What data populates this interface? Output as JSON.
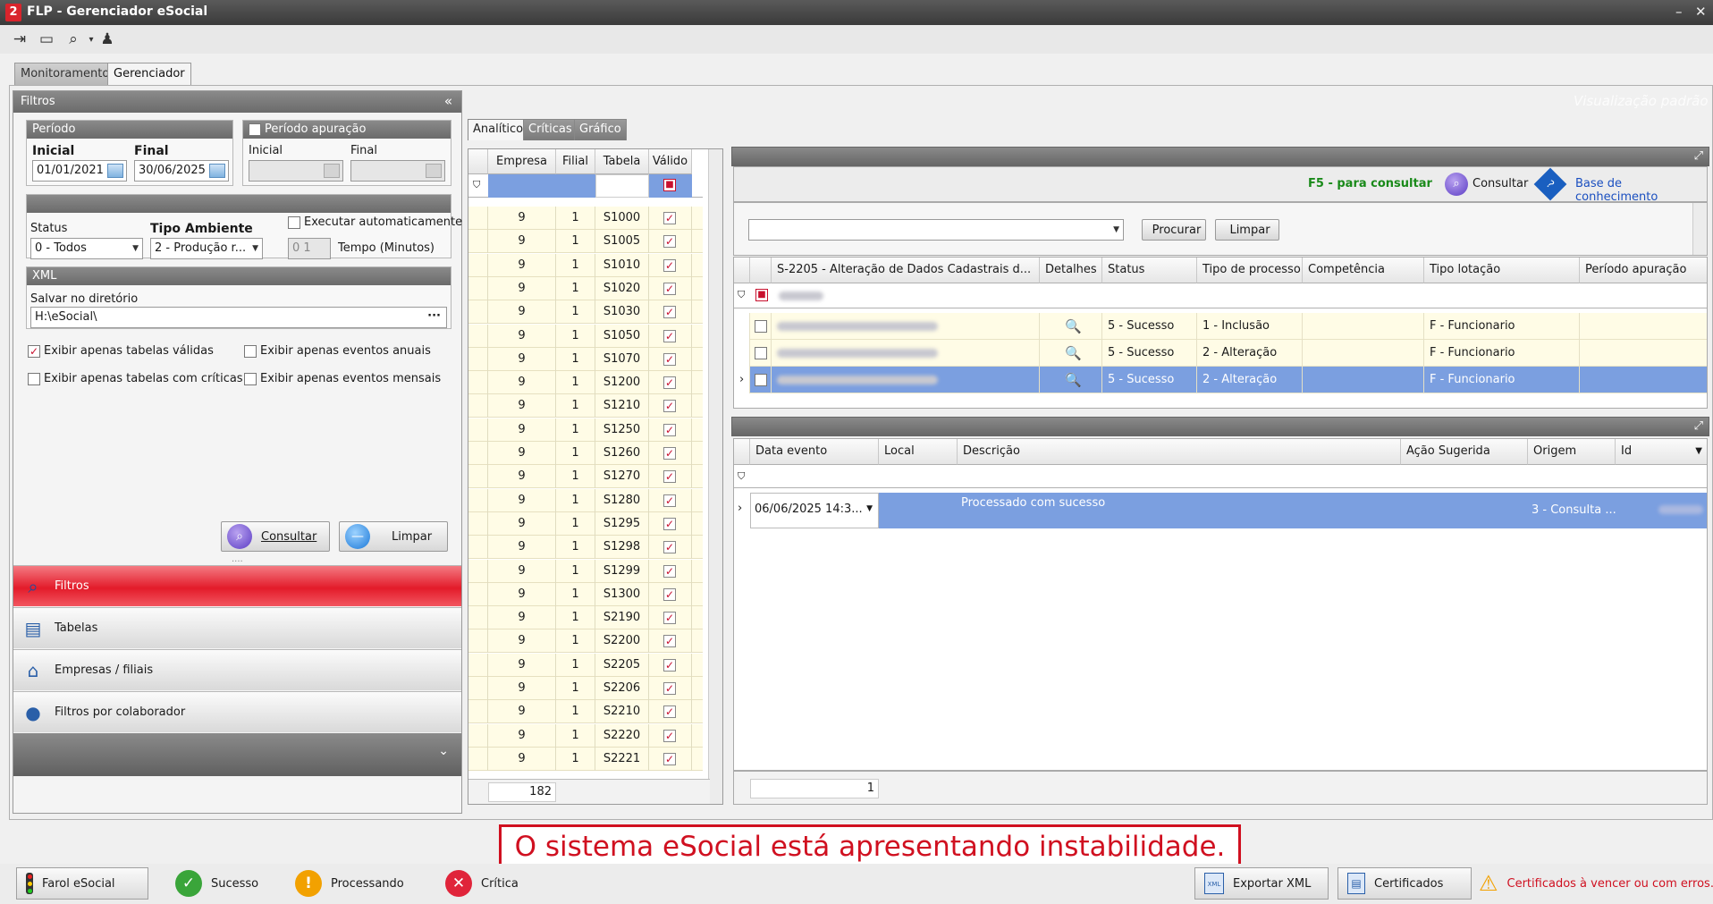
{
  "window": {
    "title": "FLP - Gerenciador eSocial",
    "logo": "2"
  },
  "toolbar": {
    "icons": [
      "exit-icon",
      "monitor-icon",
      "zoom-icon",
      "user-icon"
    ]
  },
  "main_tabs": [
    {
      "label": "Monitoramento"
    },
    {
      "label": "Gerenciador"
    }
  ],
  "watermark": "Visualização padrão",
  "filters": {
    "title": "Filtros",
    "periodo": {
      "label": "Período",
      "inicial_label": "Inicial",
      "final_label": "Final",
      "inicial": "01/01/2021",
      "final": "30/06/2025"
    },
    "periodo_apuracao": {
      "label": "Período apuração",
      "inicial_label": "Inicial",
      "final_label": "Final"
    },
    "status_label": "Status",
    "status_value": "0 - Todos",
    "tipo_ambiente_label": "Tipo Ambiente",
    "tipo_ambiente_value": "2 - Produção r...",
    "executar_label": "Executar automaticamente",
    "tempo_value": "0  1",
    "tempo_label": "Tempo (Minutos)",
    "xml": {
      "title": "XML",
      "salvar_label": "Salvar no diretório",
      "dir_value": "H:\\eSocial\\",
      "dir_button": "···"
    },
    "options": [
      {
        "label": "Exibir apenas tabelas válidas",
        "checked": true
      },
      {
        "label": "Exibir apenas eventos anuais",
        "checked": false
      },
      {
        "label": "Exibir apenas tabelas com críticas",
        "checked": false
      },
      {
        "label": "Exibir apenas eventos mensais",
        "checked": false
      }
    ],
    "consultar_button": "Consultar",
    "limpar_button": "Limpar"
  },
  "nav": [
    {
      "label": "Filtros"
    },
    {
      "label": "Tabelas"
    },
    {
      "label": "Empresas / filiais"
    },
    {
      "label": "Filtros por colaborador"
    }
  ],
  "sub_tabs": [
    {
      "label": "Analítico"
    },
    {
      "label": "Críticas"
    },
    {
      "label": "Gráfico"
    }
  ],
  "tables_grid": {
    "columns": [
      "Empresa",
      "Filial",
      "Tabela",
      "Válido"
    ],
    "rows": [
      {
        "empresa": "9",
        "filial": "1",
        "tabela": "S1000"
      },
      {
        "empresa": "9",
        "filial": "1",
        "tabela": "S1005"
      },
      {
        "empresa": "9",
        "filial": "1",
        "tabela": "S1010"
      },
      {
        "empresa": "9",
        "filial": "1",
        "tabela": "S1020"
      },
      {
        "empresa": "9",
        "filial": "1",
        "tabela": "S1030"
      },
      {
        "empresa": "9",
        "filial": "1",
        "tabela": "S1050"
      },
      {
        "empresa": "9",
        "filial": "1",
        "tabela": "S1070"
      },
      {
        "empresa": "9",
        "filial": "1",
        "tabela": "S1200"
      },
      {
        "empresa": "9",
        "filial": "1",
        "tabela": "S1210"
      },
      {
        "empresa": "9",
        "filial": "1",
        "tabela": "S1250"
      },
      {
        "empresa": "9",
        "filial": "1",
        "tabela": "S1260"
      },
      {
        "empresa": "9",
        "filial": "1",
        "tabela": "S1270"
      },
      {
        "empresa": "9",
        "filial": "1",
        "tabela": "S1280"
      },
      {
        "empresa": "9",
        "filial": "1",
        "tabela": "S1295"
      },
      {
        "empresa": "9",
        "filial": "1",
        "tabela": "S1298"
      },
      {
        "empresa": "9",
        "filial": "1",
        "tabela": "S1299"
      },
      {
        "empresa": "9",
        "filial": "1",
        "tabela": "S1300"
      },
      {
        "empresa": "9",
        "filial": "1",
        "tabela": "S2190"
      },
      {
        "empresa": "9",
        "filial": "1",
        "tabela": "S2200"
      },
      {
        "empresa": "9",
        "filial": "1",
        "tabela": "S2205"
      },
      {
        "empresa": "9",
        "filial": "1",
        "tabela": "S2206"
      },
      {
        "empresa": "9",
        "filial": "1",
        "tabela": "S2210"
      },
      {
        "empresa": "9",
        "filial": "1",
        "tabela": "S2220"
      },
      {
        "empresa": "9",
        "filial": "1",
        "tabela": "S2221"
      }
    ],
    "total": "182"
  },
  "consult_bar": {
    "hint": "F5 - para consultar",
    "consultar": "Consultar",
    "base": "Base de conhecimento"
  },
  "search": {
    "procurar": "Procurar",
    "limpar": "Limpar"
  },
  "events_grid": {
    "columns": [
      "S-2205 - Alteração de Dados Cadastrais d...",
      "Detalhes",
      "Status",
      "Tipo de processo",
      "Competência",
      "Tipo lotação",
      "Período apuração"
    ],
    "rows": [
      {
        "status": "5 - Sucesso",
        "tipo": "1 - Inclusão",
        "lotacao": "F - Funcionario",
        "selected": false
      },
      {
        "status": "5 - Sucesso",
        "tipo": "2 - Alteração",
        "lotacao": "F - Funcionario",
        "selected": false
      },
      {
        "status": "5 - Sucesso",
        "tipo": "2 - Alteração",
        "lotacao": "F - Funcionario",
        "selected": true
      }
    ]
  },
  "detail_grid": {
    "columns": [
      "Data evento",
      "Local",
      "Descrição",
      "Ação Sugerida",
      "Origem",
      "Id"
    ],
    "rows": [
      {
        "data": "06/06/2025 14:3...",
        "descricao": "Processado com sucesso",
        "origem": "3 - Consulta ..."
      }
    ],
    "count": "1"
  },
  "alert": "O sistema eSocial está apresentando instabilidade.",
  "status_bar": {
    "farol": "Farol eSocial",
    "sucesso": "Sucesso",
    "processando": "Processando",
    "critica": "Crítica",
    "exportar": "Exportar XML",
    "certificados": "Certificados",
    "cert_warning": "Certificados à vencer ou com erros."
  },
  "colors": {
    "accent_red": "#e31b2a",
    "selection_blue": "#7b9fe0",
    "success_green": "#1a8a1a",
    "link_blue": "#1a4fc0"
  }
}
